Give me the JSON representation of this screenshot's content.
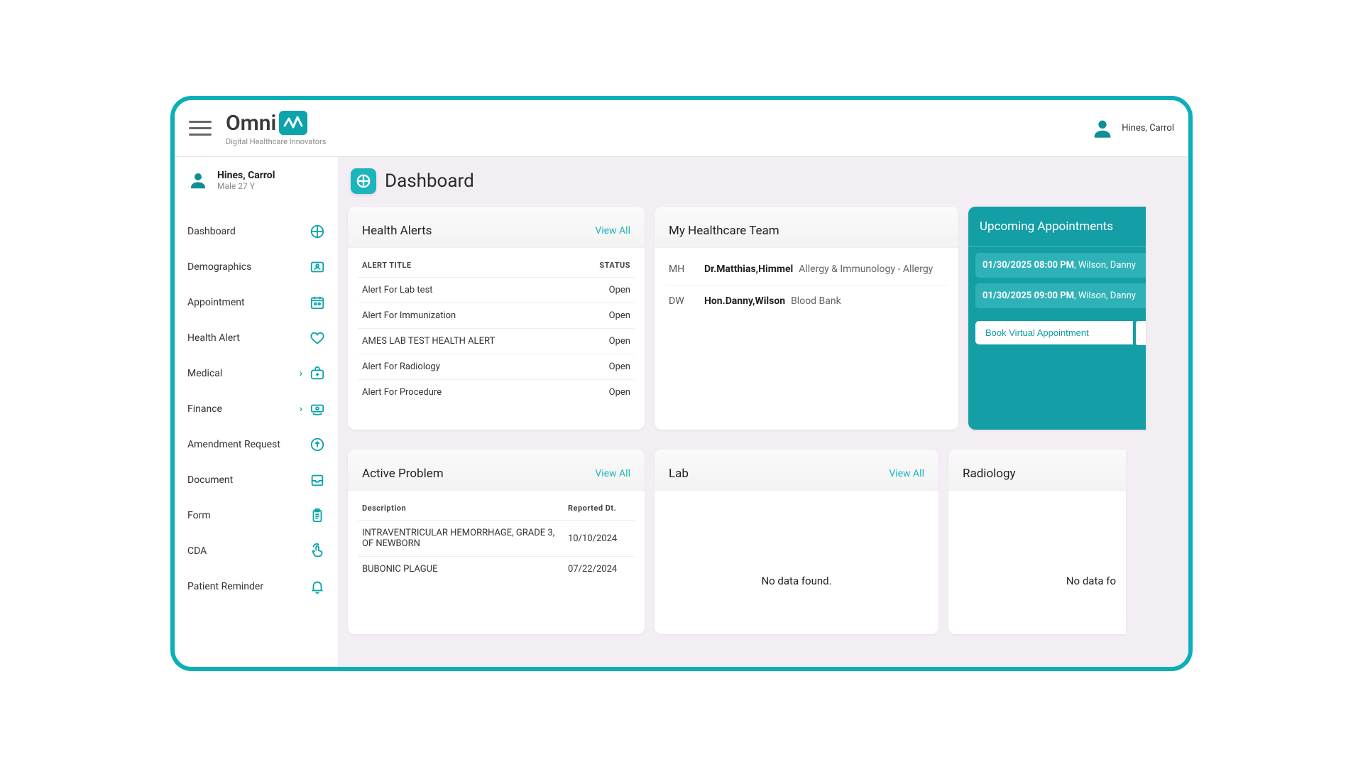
{
  "brand": {
    "name": "Omni",
    "tagline": "Digital Healthcare Innovators"
  },
  "topUser": {
    "name": "Hines, Carrol"
  },
  "sideUser": {
    "name": "Hines, Carrol",
    "sub": "Male 27 Y"
  },
  "nav": {
    "dashboard": "Dashboard",
    "demographics": "Demographics",
    "appointment": "Appointment",
    "healthAlert": "Health Alert",
    "medical": "Medical",
    "finance": "Finance",
    "amendment": "Amendment Request",
    "document": "Document",
    "form": "Form",
    "cda": "CDA",
    "reminder": "Patient Reminder"
  },
  "page": {
    "title": "Dashboard"
  },
  "alerts": {
    "title": "Health Alerts",
    "viewAll": "View All",
    "colTitle": "ALERT TITLE",
    "colStatus": "STATUS",
    "rows": [
      {
        "title": "Alert For Lab test",
        "status": "Open"
      },
      {
        "title": "Alert For Immunization",
        "status": "Open"
      },
      {
        "title": "AMES LAB TEST HEALTH ALERT",
        "status": "Open"
      },
      {
        "title": "Alert For Radiology",
        "status": "Open"
      },
      {
        "title": "Alert For Procedure",
        "status": "Open"
      }
    ]
  },
  "team": {
    "title": "My Healthcare Team",
    "rows": [
      {
        "initials": "MH",
        "name": "Dr.Matthias,Himmel",
        "spec": "Allergy & Immunology - Allergy"
      },
      {
        "initials": "DW",
        "name": "Hon.Danny,Wilson",
        "spec": "Blood Bank"
      }
    ]
  },
  "appts": {
    "title": "Upcoming Appointments",
    "items": [
      {
        "dt": "01/30/2025 08:00 PM",
        "who": "Wilson, Danny"
      },
      {
        "dt": "01/30/2025 09:00 PM",
        "who": "Wilson, Danny"
      }
    ],
    "book": "Book Virtual Appointment"
  },
  "problem": {
    "title": "Active Problem",
    "viewAll": "View All",
    "colDesc": "Description",
    "colDate": "Reported Dt.",
    "rows": [
      {
        "d": "INTRAVENTRICULAR HEMORRHAGE, GRADE 3, OF NEWBORN",
        "dt": "10/10/2024"
      },
      {
        "d": "BUBONIC PLAGUE",
        "dt": "07/22/2024"
      }
    ]
  },
  "lab": {
    "title": "Lab",
    "viewAll": "View All",
    "empty": "No data found."
  },
  "rad": {
    "title": "Radiology",
    "empty": "No data fo"
  }
}
